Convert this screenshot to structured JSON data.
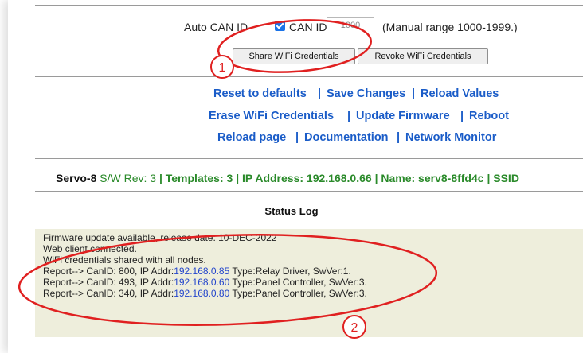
{
  "can_row": {
    "auto_label": "Auto CAN ID",
    "auto_checked": true,
    "canid_label": "CAN ID",
    "canid_value": "1000",
    "range_note": "(Manual range 1000-1999.)"
  },
  "buttons": {
    "share": "Share WiFi Credentials",
    "revoke": "Revoke WiFi Credentials"
  },
  "links": {
    "line1": [
      "Reset to defaults",
      "Save Changes",
      "Reload Values"
    ],
    "line2": [
      "Erase WiFi Credentials",
      "Update Firmware",
      "Reboot"
    ],
    "line3": [
      "Reload page",
      "Documentation",
      "Network Monitor"
    ],
    "separator": " | "
  },
  "device_info": {
    "name_prefix": "Servo-8",
    "sw_rev": "S/W Rev: 3",
    "templates": "Templates: 3",
    "ip": "IP Address: 192.168.0.66",
    "name": "Name: serv8-8ffd4c",
    "ssid": "SSID"
  },
  "status_log": {
    "title": "Status Log",
    "lines": [
      "Firmware update available, release date: 10-DEC-2022",
      "Web client connected.",
      "WiFi credentials shared with all nodes."
    ],
    "reports": [
      {
        "prefix": "Report--> CanID: 800, IP Addr:",
        "ip": "192.168.0.85",
        "suffix": " Type:Relay Driver, SwVer:1."
      },
      {
        "prefix": "Report--> CanID: 493, IP Addr:",
        "ip": "192.168.0.60",
        "suffix": " Type:Panel Controller, SwVer:3."
      },
      {
        "prefix": "Report--> CanID: 340, IP Addr:",
        "ip": "192.168.0.80",
        "suffix": " Type:Panel Controller, SwVer:3."
      }
    ]
  },
  "annotations": {
    "marker1": "1",
    "marker2": "2",
    "color": "#e02020"
  },
  "colors": {
    "link": "#1a5cc8",
    "green": "#2a8a2a",
    "log_bg": "#eeeedc",
    "ip_link": "#2244cc"
  }
}
